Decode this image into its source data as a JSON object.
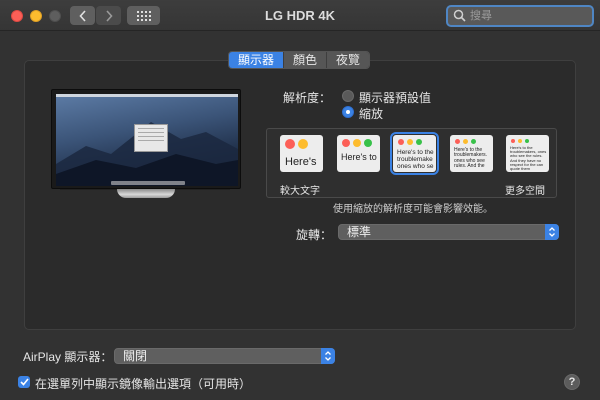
{
  "window": {
    "title": "LG HDR 4K",
    "search_placeholder": "搜尋"
  },
  "tabs": [
    {
      "label": "顯示器",
      "active": true
    },
    {
      "label": "顏色",
      "active": false
    },
    {
      "label": "夜覽",
      "active": false
    }
  ],
  "resolution": {
    "label": "解析度：",
    "options": [
      {
        "label": "顯示器預設值",
        "selected": false
      },
      {
        "label": "縮放",
        "selected": true
      }
    ]
  },
  "scale": {
    "thumbnails": [
      {
        "text": "Here's",
        "selected": false
      },
      {
        "text": "Here's to",
        "selected": false
      },
      {
        "text": "Here's to the troublemake ones who se",
        "selected": true
      },
      {
        "text": "Here's to the troublemakers. ones who see rules. And the",
        "selected": false
      },
      {
        "text": "Here's to the troublemakers, ones who see the rules. And they have no respect for the can quote them",
        "selected": false
      }
    ],
    "left_label": "較大文字",
    "right_label": "更多空間",
    "note": "使用縮放的解析度可能會影響效能。"
  },
  "rotation": {
    "label": "旋轉：",
    "value": "標準"
  },
  "airplay": {
    "label": "AirPlay 顯示器：",
    "value": "關閉"
  },
  "mirroring": {
    "label": "在選單列中顯示鏡像輸出選項（可用時）",
    "checked": true
  },
  "help_label": "?",
  "colors": {
    "accent": "#3b82e4",
    "close": "#fc5f57",
    "minimize": "#fdbc2e"
  }
}
